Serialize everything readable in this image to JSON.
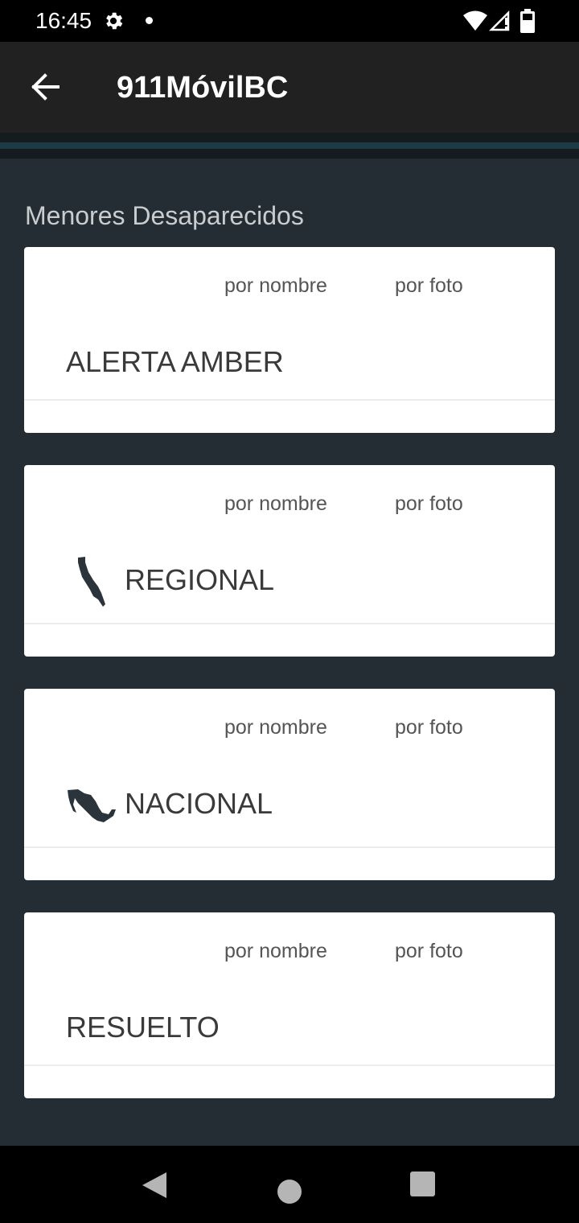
{
  "status_bar": {
    "time": "16:45",
    "icons": [
      "gear-icon",
      "notification-dot-icon",
      "wifi-icon",
      "signal-icon",
      "battery-icon"
    ]
  },
  "app_bar": {
    "title": "911MóvilBC",
    "back_icon": "arrow-back-icon"
  },
  "section": {
    "title": "Menores Desaparecidos"
  },
  "cards": [
    {
      "label": "ALERTA AMBER",
      "by_name": "por nombre",
      "by_photo": "por foto",
      "icon": ""
    },
    {
      "label": "REGIONAL",
      "by_name": "por nombre",
      "by_photo": "por foto",
      "icon": "baja-california-map-icon"
    },
    {
      "label": "NACIONAL",
      "by_name": "por nombre",
      "by_photo": "por foto",
      "icon": "mexico-map-icon"
    },
    {
      "label": "RESUELTO",
      "by_name": "por nombre",
      "by_photo": "por foto",
      "icon": ""
    }
  ],
  "nav_bar": {
    "icons": [
      "nav-back-icon",
      "nav-home-icon",
      "nav-recents-icon"
    ]
  },
  "colors": {
    "background": "#232d33",
    "app_bar": "#212121",
    "card": "#ffffff",
    "accent_stripe": "#1c3b46"
  }
}
